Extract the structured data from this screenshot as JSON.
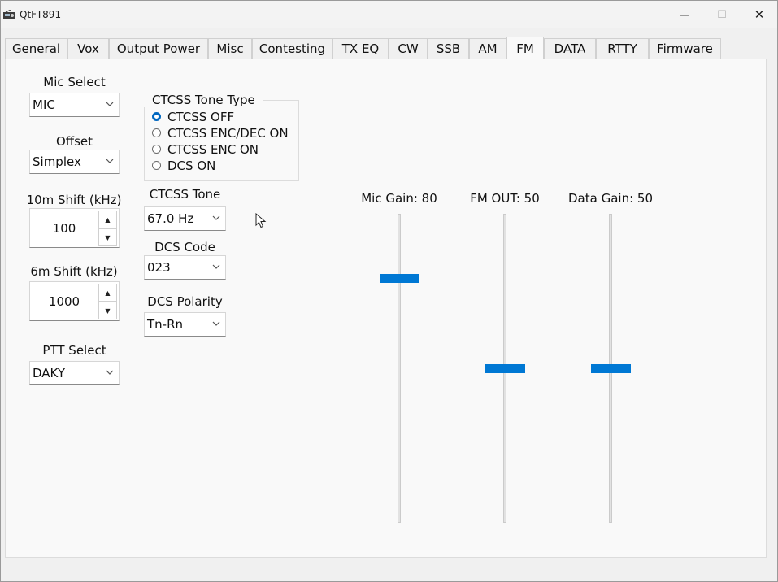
{
  "window": {
    "title": "QtFT891",
    "minimize": "—",
    "maximize": "☐",
    "close": "✕",
    "icon": "radio-app-icon"
  },
  "tabs": [
    {
      "label": "General"
    },
    {
      "label": "Vox"
    },
    {
      "label": "Output Power"
    },
    {
      "label": "Misc"
    },
    {
      "label": "Contesting"
    },
    {
      "label": "TX EQ"
    },
    {
      "label": "CW"
    },
    {
      "label": "SSB"
    },
    {
      "label": "AM"
    },
    {
      "label": "FM",
      "active": true
    },
    {
      "label": "DATA"
    },
    {
      "label": "RTTY"
    },
    {
      "label": "Firmware"
    }
  ],
  "left": {
    "mic_select": {
      "label": "Mic Select",
      "value": "MIC"
    },
    "offset": {
      "label": "Offset",
      "value": "Simplex"
    },
    "shift10": {
      "label": "10m Shift (kHz)",
      "value": "100",
      "up": "▲",
      "down": "▼"
    },
    "shift6": {
      "label": "6m Shift (kHz)",
      "value": "1000",
      "up": "▲",
      "down": "▼"
    },
    "ptt": {
      "label": "PTT Select",
      "value": "DAKY"
    }
  },
  "ctcss_group": {
    "title": "CTCSS Tone Type",
    "options": [
      {
        "label": "CTCSS OFF",
        "checked": true
      },
      {
        "label": "CTCSS ENC/DEC ON",
        "checked": false
      },
      {
        "label": "CTCSS ENC ON",
        "checked": false
      },
      {
        "label": "DCS ON",
        "checked": false
      }
    ]
  },
  "middle": {
    "ctcss_tone": {
      "label": "CTCSS Tone",
      "value": "67.0 Hz"
    },
    "dcs_code": {
      "label": "DCS Code",
      "value": "023"
    },
    "dcs_polarity": {
      "label": "DCS Polarity",
      "value": "Tn-Rn"
    }
  },
  "sliders": [
    {
      "label": "Mic Gain: 80",
      "value": 80
    },
    {
      "label": "FM OUT: 50",
      "value": 50
    },
    {
      "label": "Data Gain: 50",
      "value": 50
    }
  ],
  "colors": {
    "accent": "#0078d4",
    "radio_checked": "#0067c0"
  }
}
